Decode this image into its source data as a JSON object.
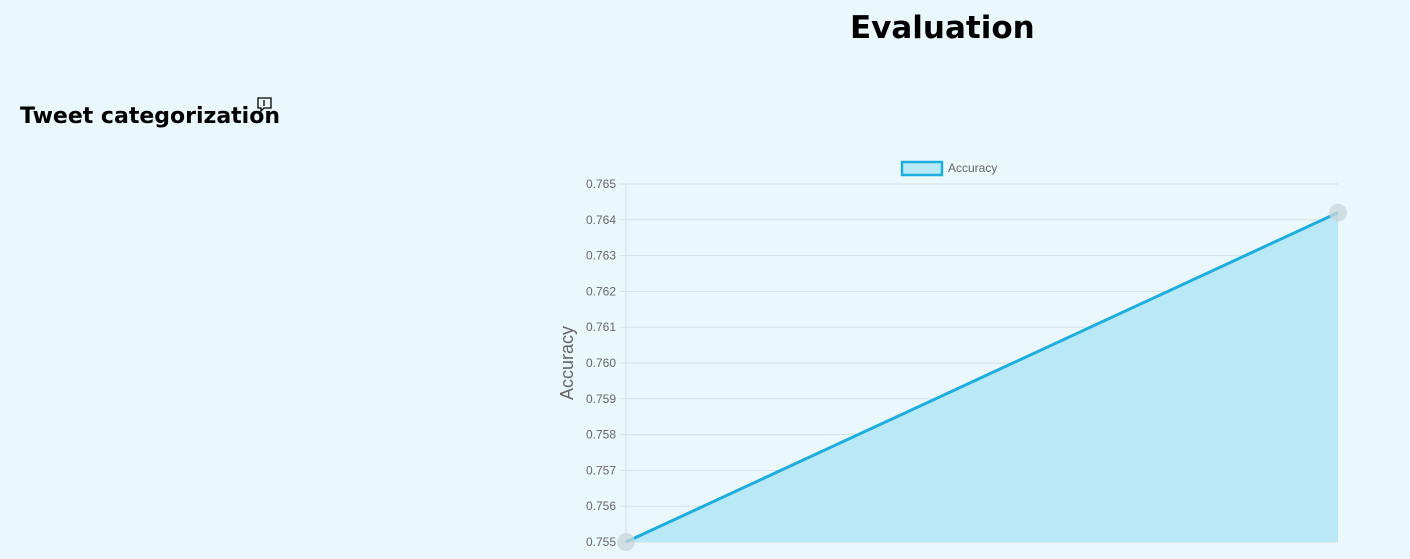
{
  "header": {
    "title": "Evaluation"
  },
  "section": {
    "title": "Tweet categorization",
    "icon": "bookmark-icon"
  },
  "colors": {
    "background": "#eaf8fc",
    "line": "#1eaede",
    "fill": "#b9e8f6",
    "grid": "#d3e0e4",
    "point": "#c8d6da"
  },
  "chart_data": {
    "type": "area",
    "series": [
      {
        "name": "Accuracy",
        "values": [
          0.755,
          0.7642
        ]
      }
    ],
    "x": [
      1,
      2
    ],
    "ylabel": "Accuracy",
    "xlabel": "",
    "ylim": [
      0.755,
      0.765
    ],
    "yticks": [
      "0.765",
      "0.764",
      "0.763",
      "0.762",
      "0.761",
      "0.760",
      "0.759",
      "0.758",
      "0.757",
      "0.756",
      "0.755"
    ],
    "grid": true,
    "legend": "top-center"
  }
}
